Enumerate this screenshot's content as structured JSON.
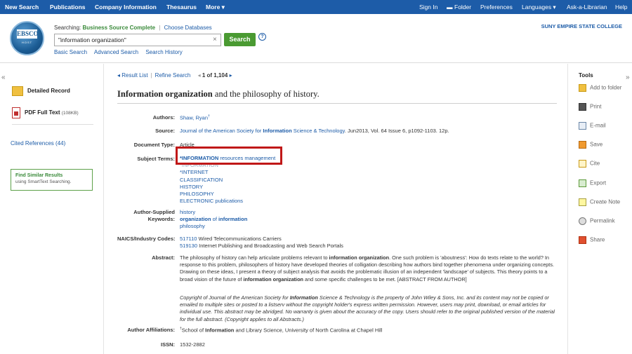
{
  "topnav": {
    "left": [
      "New Search",
      "Publications",
      "Company Information",
      "Thesaurus",
      "More ▾"
    ],
    "right": [
      "Sign In",
      "Folder",
      "Preferences",
      "Languages ▾",
      "Ask-a-Librarian",
      "Help"
    ]
  },
  "header": {
    "searching_label": "Searching:",
    "database": "Business Source Complete",
    "choose_db": "Choose Databases",
    "query": "\"information organization\"",
    "search_button": "Search",
    "links": [
      "Basic Search",
      "Advanced Search",
      "Search History"
    ],
    "institution": "SUNY EMPIRE STATE COLLEGE",
    "logo_word": "EBSCO",
    "logo_sub": "HOST"
  },
  "left": {
    "detailed_record": "Detailed Record",
    "pdf": "PDF Full Text",
    "pdf_size": "(108KB)",
    "cited": "Cited References (44)",
    "similar_title": "Find Similar Results",
    "similar_sub": "using SmartText Searching."
  },
  "tools": {
    "heading": "Tools",
    "items": [
      "Add to folder",
      "Print",
      "E-mail",
      "Save",
      "Cite",
      "Export",
      "Create Note",
      "Permalink",
      "Share"
    ]
  },
  "record": {
    "result_list": "◂ Result List",
    "refine": "Refine Search",
    "position": "1 of 1,104",
    "title_bold": "Information organization",
    "title_rest": " and the philosophy of history.",
    "authors_label": "Authors:",
    "authors": "Shaw, Ryan",
    "source_label": "Source:",
    "source_a": "Journal of the American Society for ",
    "source_b": "Information",
    "source_c": " Science & Technology",
    "source_rest": ". Jun2013, Vol. 64 Issue 6, p1092-1103. 12p.",
    "doctype_label": "Document Type:",
    "doctype": "Article",
    "subject_label": "Subject Terms:",
    "subject_first_bold": "*INFORMATION",
    "subject_first_rest": " resources management",
    "subjects": [
      "*INFORMATION",
      "*INTERNET",
      "CLASSIFICATION",
      "HISTORY",
      "PHILOSOPHY",
      "ELECTRONIC publications"
    ],
    "kw_label_1": "Author-Supplied",
    "kw_label_2": "Keywords:",
    "kw_1": "history",
    "kw_2_a": "organization",
    "kw_2_b": " of ",
    "kw_2_c": "information",
    "kw_3": "philosophy",
    "naics_label": "NAICS/Industry Codes:",
    "naics_1_code": "517110",
    "naics_1_text": " Wired Telecommunications Carriers",
    "naics_2_code": "519130",
    "naics_2_text": " Internet Publishing and Broadcasting and Web Search Portals",
    "abstract_label": "Abstract:",
    "abstract_p1": "The philosophy of history can help articulate problems relevant to ",
    "abstract_b1": "information organization",
    "abstract_p2": ". One such problem is 'aboutness': How do texts relate to the world? In response to this problem, philosophers of history have developed theories of colligation describing how authors bind together phenomena under organizing concepts. Drawing on these ideas, I present a theory of subject analysis that avoids the problematic illusion of an independent 'landscape' of subjects. This theory points to a broad vision of the future of ",
    "abstract_b2": "information organization",
    "abstract_p3": " and some specific challenges to be met. [ABSTRACT FROM AUTHOR]",
    "copyright_a": "Copyright of Journal of the American Society for ",
    "copyright_b": "Information",
    "copyright_c": " Science & Technology is the property of John Wiley & Sons, Inc. and its content may not be copied or emailed to multiple sites or posted to a listserv without the copyright holder's express written permission. However, users may print, download, or email articles for individual use. This abstract may be abridged. No warranty is given about the accuracy of the copy. Users should refer to the original published version of the material for the full abstract. (Copyright applies to all Abstracts.)",
    "affil_label": "Author Affiliations:",
    "affil_a": "School of ",
    "affil_b": "Information",
    "affil_c": " and Library Science, University of North Carolina at Chapel Hill",
    "issn_label": "ISSN:",
    "issn": "1532-2882"
  }
}
